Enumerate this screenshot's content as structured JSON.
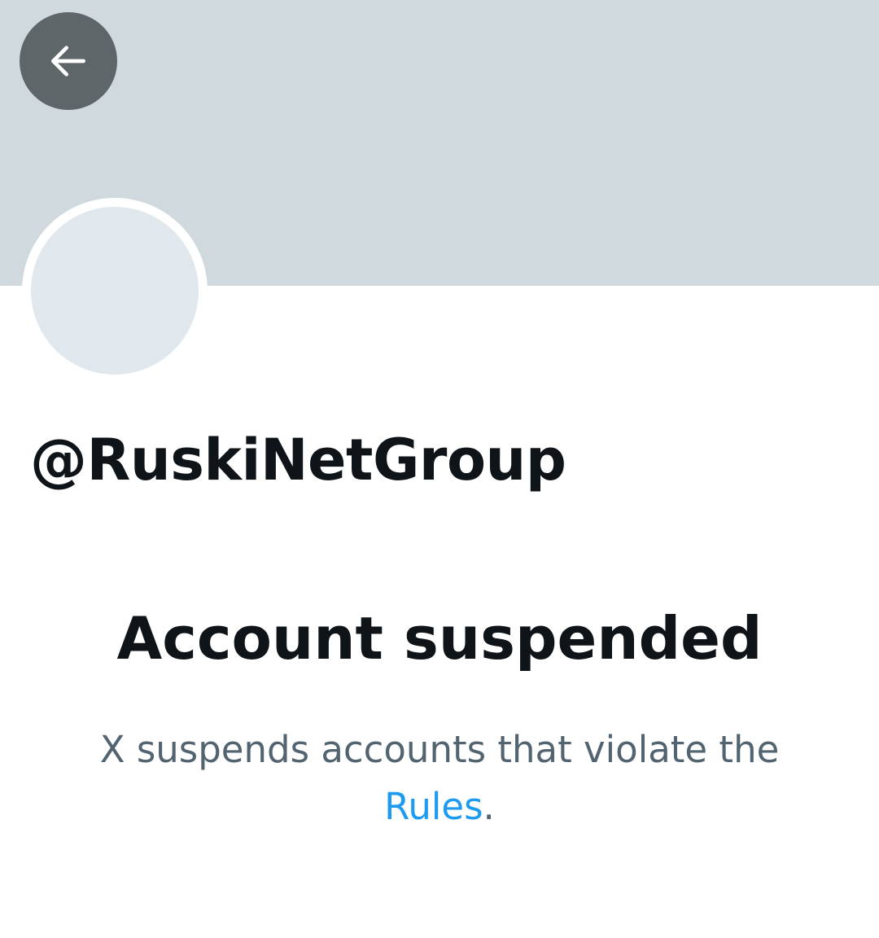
{
  "header": {
    "back_icon": "arrow-left-icon"
  },
  "profile": {
    "handle": "@RuskiNetGroup"
  },
  "suspension": {
    "title": "Account suspended",
    "message_prefix": "X suspends accounts that violate the",
    "rules_link": "Rules",
    "message_suffix": "."
  },
  "colors": {
    "banner": "#cfd9de",
    "back_button": "#5f6669",
    "avatar_placeholder": "#e1e8ed",
    "primary_text": "#0f1419",
    "secondary_text": "#536471",
    "link": "#1d9bf0"
  }
}
